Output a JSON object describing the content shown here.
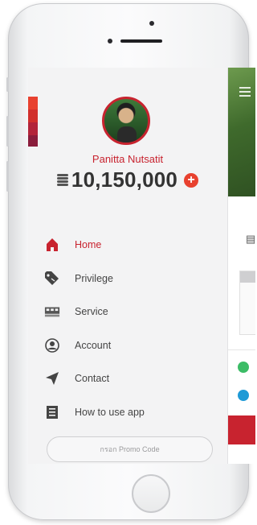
{
  "profile": {
    "name": "Panitta Nutsatit",
    "balance": "10,150,000",
    "add_symbol": "+"
  },
  "menu": {
    "items": [
      {
        "label": "Home",
        "icon": "home-icon",
        "active": true
      },
      {
        "label": "Privilege",
        "icon": "tag-icon",
        "active": false
      },
      {
        "label": "Service",
        "icon": "service-icon",
        "active": false
      },
      {
        "label": "Account",
        "icon": "user-icon",
        "active": false
      },
      {
        "label": "Contact",
        "icon": "send-icon",
        "active": false
      },
      {
        "label": "How to use app",
        "icon": "guide-icon",
        "active": false
      }
    ]
  },
  "promo": {
    "placeholder": "กรอก Promo Code"
  },
  "colors": {
    "accent": "#c8232f",
    "add_button": "#e8412f",
    "text": "#444444",
    "drawer_bg": "#f3f3f4",
    "brand_strip": [
      "#e8412f",
      "#d12f2c",
      "#b3243a",
      "#8a1d3c"
    ]
  }
}
